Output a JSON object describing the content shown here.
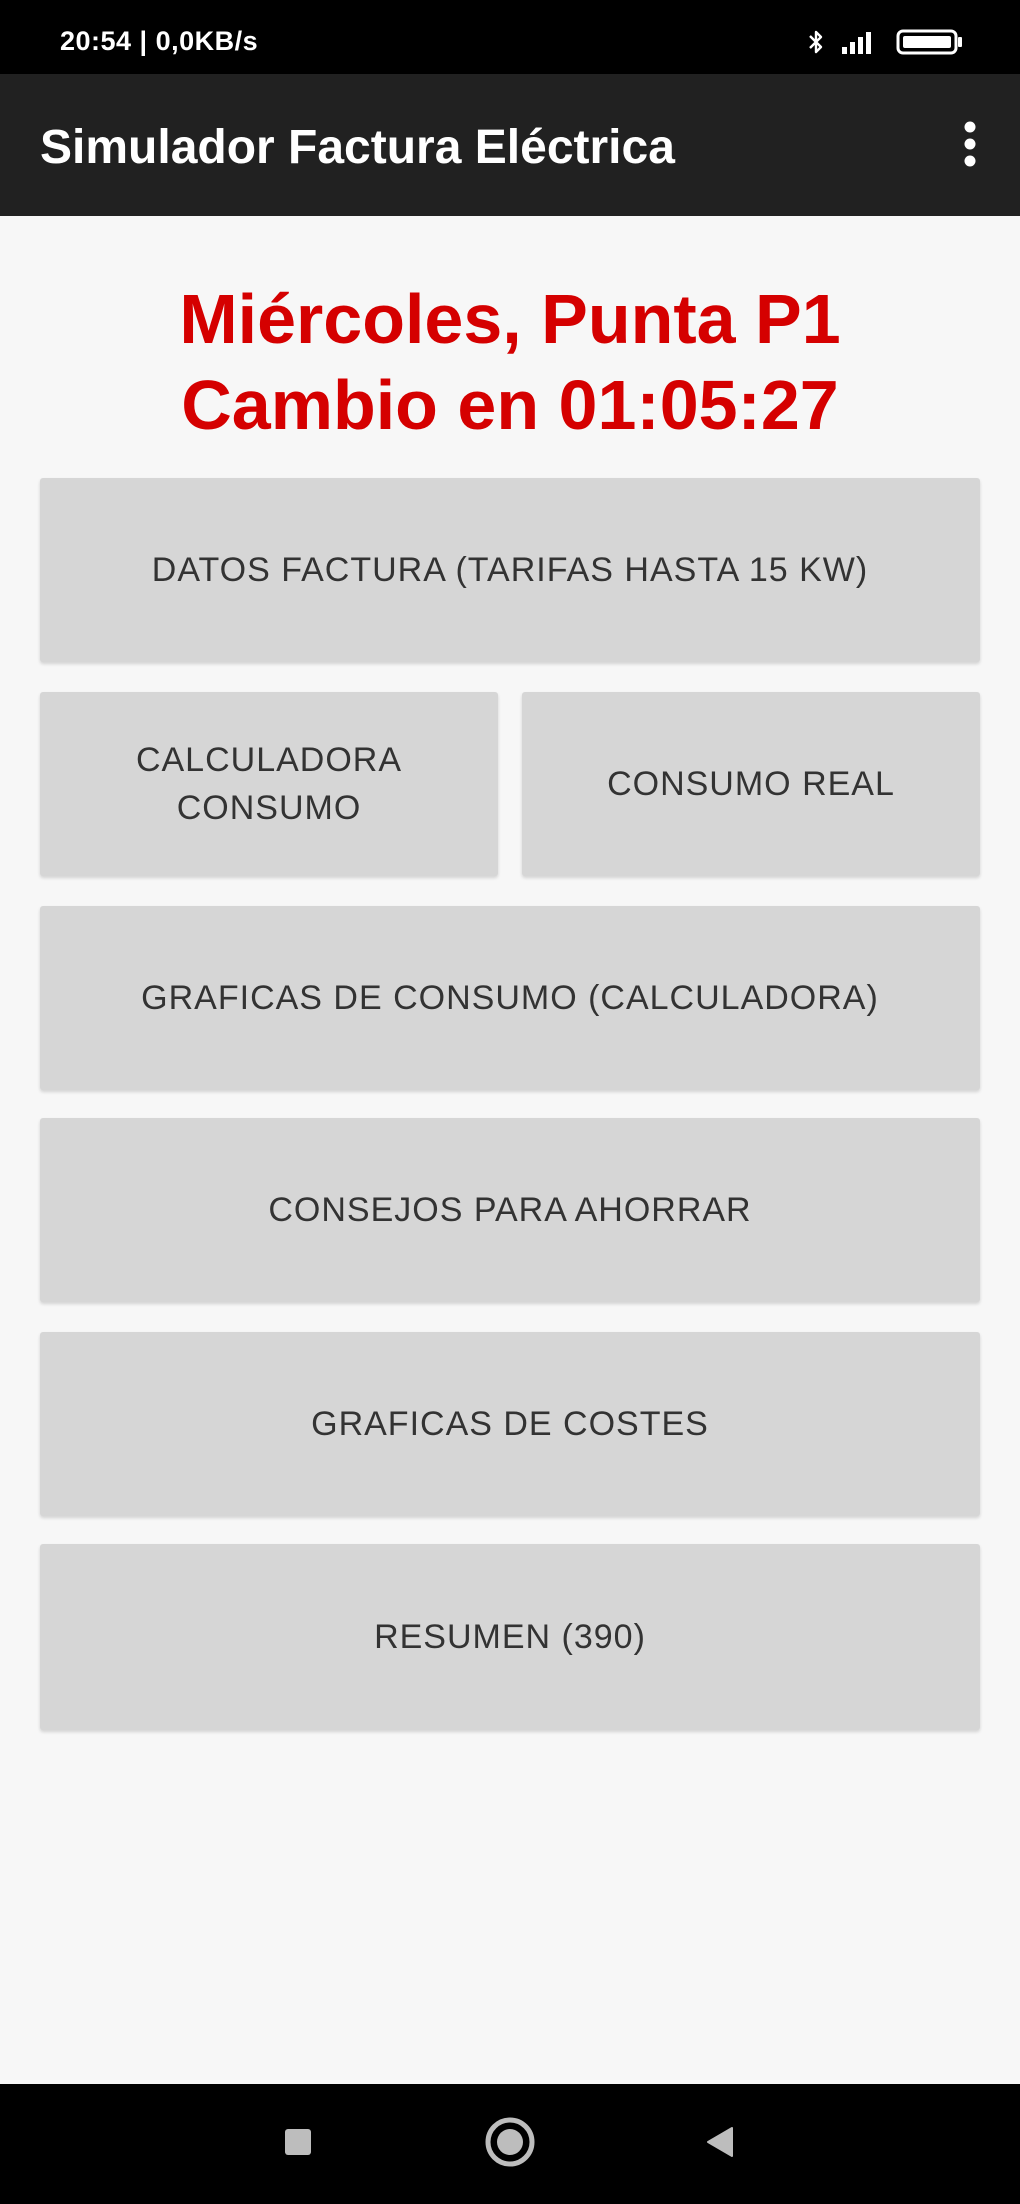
{
  "status_bar": {
    "time_speed": "20:54 | 0,0KB/s"
  },
  "app_bar": {
    "title": "Simulador Factura Eléctrica"
  },
  "headline": {
    "line1": "Miércoles, Punta P1",
    "line2": "Cambio en 01:05:27"
  },
  "buttons": {
    "datos_factura": "DATOS FACTURA (TARIFAS HASTA 15 KW)",
    "calculadora_consumo": "CALCULADORA CONSUMO",
    "consumo_real": "CONSUMO REAL",
    "graficas_consumo": "GRAFICAS DE CONSUMO (CALCULADORA)",
    "consejos": "CONSEJOS PARA AHORRAR",
    "graficas_costes": "GRAFICAS DE COSTES",
    "resumen": "RESUMEN (390)"
  },
  "colors": {
    "headline": "#d50000",
    "app_bar": "#212121",
    "button_bg": "#d6d6d6",
    "background": "#f7f7f7"
  },
  "icons": {
    "status": [
      "bluetooth-icon",
      "signal-icon",
      "battery-icon"
    ],
    "app_bar": "overflow-menu-icon",
    "nav": [
      "recents-icon",
      "home-icon",
      "back-icon"
    ]
  }
}
